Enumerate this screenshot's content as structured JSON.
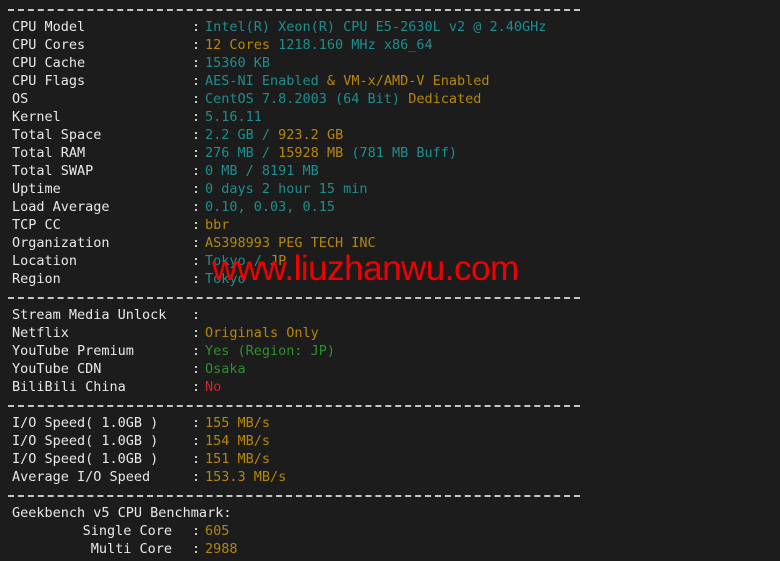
{
  "terminal": {
    "background_color": "#1c1c1c",
    "colors": {
      "label": "#e8e8e8",
      "teal": "#1f8e8e",
      "gold": "#b6870c",
      "green": "#2f8f2f",
      "red": "#c42b2b",
      "separator": "#c8c5bd",
      "watermark": "#f00000"
    },
    "watermark": "www.liuzhanwu.com",
    "sections": [
      {
        "name": "system-info",
        "rows": [
          {
            "label": "CPU Model",
            "parts": [
              {
                "text": "Intel(R) Xeon(R) CPU E5-2630L v2 @ 2.40GHz",
                "color": "teal"
              }
            ]
          },
          {
            "label": "CPU Cores",
            "parts": [
              {
                "text": "12 Cores",
                "color": "gold"
              },
              {
                "text": " 1218.160 MHz x86_64",
                "color": "teal"
              }
            ]
          },
          {
            "label": "CPU Cache",
            "parts": [
              {
                "text": "15360 KB",
                "color": "teal"
              }
            ]
          },
          {
            "label": "CPU Flags",
            "parts": [
              {
                "text": "AES-NI Enabled",
                "color": "teal"
              },
              {
                "text": " & ",
                "color": "gold"
              },
              {
                "text": "VM-x/AMD-V Enabled",
                "color": "gold"
              }
            ]
          },
          {
            "label": "OS",
            "parts": [
              {
                "text": "CentOS 7.8.2003 (64 Bit) ",
                "color": "teal"
              },
              {
                "text": "Dedicated",
                "color": "gold"
              }
            ]
          },
          {
            "label": "Kernel",
            "parts": [
              {
                "text": "5.16.11",
                "color": "teal"
              }
            ]
          },
          {
            "label": "Total Space",
            "parts": [
              {
                "text": "2.2 GB ",
                "color": "teal"
              },
              {
                "text": "/ ",
                "color": "teal"
              },
              {
                "text": "923.2 GB",
                "color": "gold"
              }
            ]
          },
          {
            "label": "Total RAM",
            "parts": [
              {
                "text": "276 MB ",
                "color": "teal"
              },
              {
                "text": "/ ",
                "color": "teal"
              },
              {
                "text": "15928 MB",
                "color": "gold"
              },
              {
                "text": " (781 MB Buff)",
                "color": "teal"
              }
            ]
          },
          {
            "label": "Total SWAP",
            "parts": [
              {
                "text": "0 MB / 8191 MB",
                "color": "teal"
              }
            ]
          },
          {
            "label": "Uptime",
            "parts": [
              {
                "text": "0 days 2 hour 15 min",
                "color": "teal"
              }
            ]
          },
          {
            "label": "Load Average",
            "parts": [
              {
                "text": "0.10, 0.03, 0.15",
                "color": "teal"
              }
            ]
          },
          {
            "label": "TCP CC",
            "parts": [
              {
                "text": "bbr",
                "color": "gold"
              }
            ]
          },
          {
            "label": "Organization",
            "parts": [
              {
                "text": "AS398993 PEG TECH INC",
                "color": "gold"
              }
            ]
          },
          {
            "label": "Location",
            "parts": [
              {
                "text": "Tokyo ",
                "color": "teal"
              },
              {
                "text": "/ ",
                "color": "teal"
              },
              {
                "text": "JP",
                "color": "gold"
              }
            ]
          },
          {
            "label": "Region",
            "parts": [
              {
                "text": "Tokyo",
                "color": "teal"
              }
            ]
          }
        ]
      },
      {
        "name": "stream-media-unlock",
        "rows": [
          {
            "label": "Stream Media Unlock",
            "parts": []
          },
          {
            "label": "Netflix",
            "parts": [
              {
                "text": "Originals Only",
                "color": "gold"
              }
            ]
          },
          {
            "label": "YouTube Premium",
            "parts": [
              {
                "text": "Yes (Region: JP)",
                "color": "green"
              }
            ]
          },
          {
            "label": "YouTube CDN",
            "parts": [
              {
                "text": "Osaka",
                "color": "green"
              }
            ]
          },
          {
            "label": "BiliBili China",
            "parts": [
              {
                "text": "No",
                "color": "red"
              }
            ]
          }
        ]
      },
      {
        "name": "io-speed",
        "rows": [
          {
            "label": "I/O Speed( 1.0GB )",
            "parts": [
              {
                "text": "155 MB/s",
                "color": "gold"
              }
            ]
          },
          {
            "label": "I/O Speed( 1.0GB )",
            "parts": [
              {
                "text": "154 MB/s",
                "color": "gold"
              }
            ]
          },
          {
            "label": "I/O Speed( 1.0GB )",
            "parts": [
              {
                "text": "151 MB/s",
                "color": "gold"
              }
            ]
          },
          {
            "label": "Average I/O Speed",
            "parts": [
              {
                "text": "153.3 MB/s",
                "color": "gold"
              }
            ]
          }
        ]
      },
      {
        "name": "geekbench",
        "heading": "Geekbench v5 CPU Benchmark:",
        "rows": [
          {
            "label": "Single Core",
            "align": "right",
            "parts": [
              {
                "text": "605",
                "color": "gold"
              }
            ]
          },
          {
            "label": "Multi Core",
            "align": "right",
            "parts": [
              {
                "text": "2988",
                "color": "gold"
              }
            ]
          }
        ]
      }
    ]
  }
}
